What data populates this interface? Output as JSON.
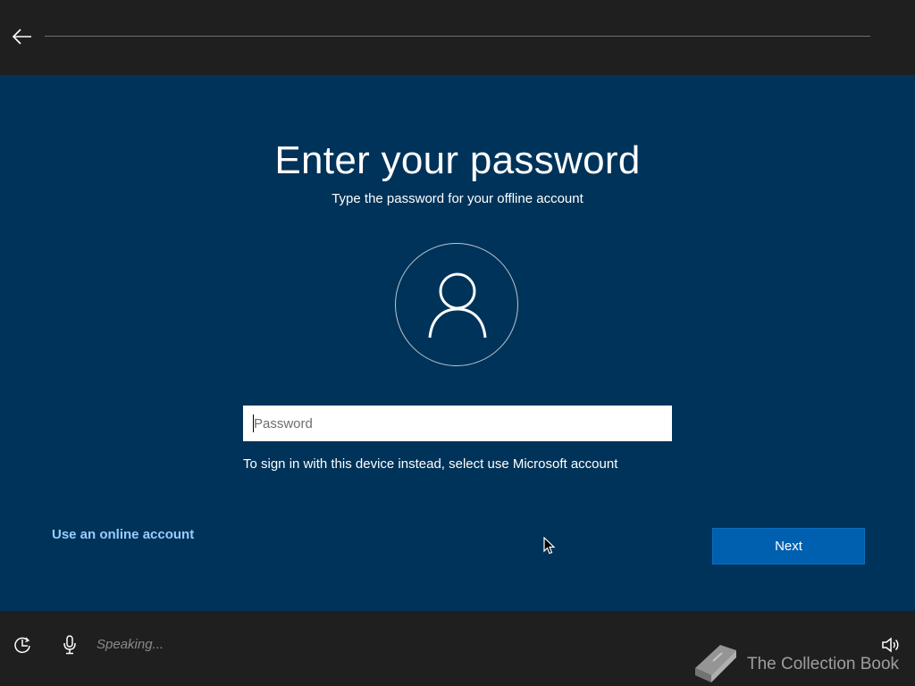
{
  "page": {
    "title": "Enter your password",
    "subtitle": "Type the password for your offline account"
  },
  "password": {
    "placeholder": "Password",
    "value": ""
  },
  "hint": "To sign in with this device instead, select use Microsoft account",
  "actions": {
    "online_account": "Use an online account",
    "next": "Next"
  },
  "bottom_bar": {
    "speech_status": "Speaking..."
  },
  "watermark": {
    "text": "The Collection Book"
  },
  "colors": {
    "background": "#003359",
    "bars": "#1f1f1f",
    "accent": "#0060b0",
    "link": "#99ccff"
  },
  "icons": {
    "back": "back-arrow-icon",
    "avatar": "user-icon",
    "ease_of_access": "ease-of-access-icon",
    "microphone": "microphone-icon",
    "volume": "volume-icon",
    "watermark": "book-icon"
  }
}
